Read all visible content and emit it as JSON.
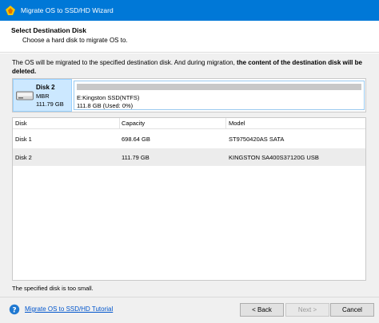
{
  "window": {
    "title": "Migrate OS to SSD/HD Wizard"
  },
  "header": {
    "title": "Select Destination Disk",
    "subtitle": "Choose a hard disk to migrate OS to."
  },
  "notice": {
    "text_plain": "The OS will be migrated to the specified destination disk. And during migration, ",
    "text_bold": "the content of the destination disk will be deleted."
  },
  "disk_map": {
    "name": "Disk 2",
    "type": "MBR",
    "size": "111.79 GB",
    "partition": {
      "label": "E:Kingston SSD(NTFS)",
      "usage": "111.8 GB (Used: 0%)",
      "used_fraction": 0
    }
  },
  "table": {
    "columns": [
      "Disk",
      "Capacity",
      "Model"
    ],
    "rows": [
      {
        "disk": "Disk 1",
        "capacity": "698.64 GB",
        "model": "ST9750420AS SATA"
      },
      {
        "disk": "Disk 2",
        "capacity": "111.79 GB",
        "model": "KINGSTON SA400S37120G USB"
      }
    ]
  },
  "status": {
    "text": "The specified disk is too small."
  },
  "footer": {
    "help_link": "Migrate OS to SSD/HD Tutorial",
    "back_label": "< Back",
    "next_label": "Next >",
    "cancel_label": "Cancel"
  },
  "colors": {
    "titlebar": "#0078d7",
    "selected_disk": "#cce8ff",
    "link": "#0055cc"
  }
}
